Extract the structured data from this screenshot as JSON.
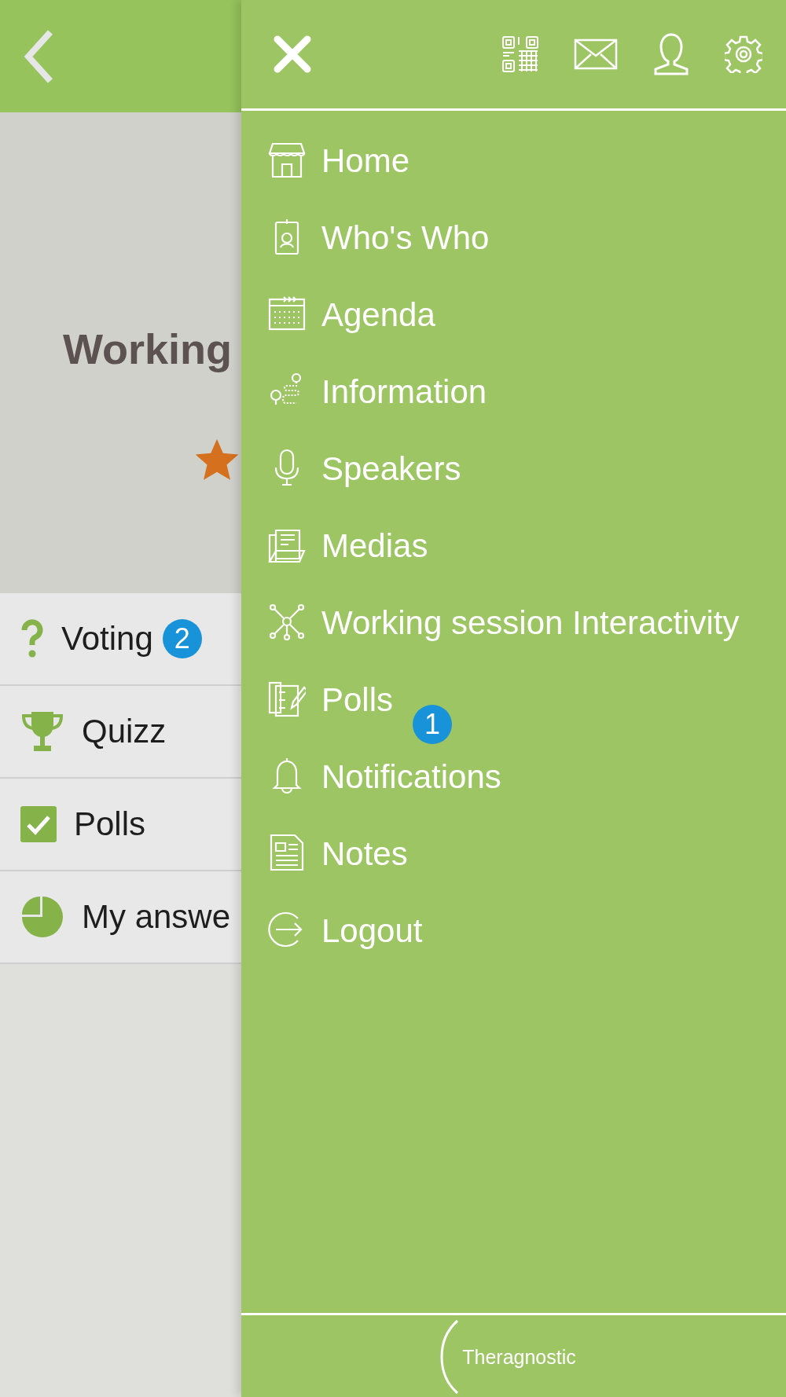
{
  "page": {
    "title": "Working",
    "list": [
      {
        "label": "Voting",
        "kind": "question",
        "badge": "2"
      },
      {
        "label": "Quizz",
        "kind": "trophy"
      },
      {
        "label": "Polls",
        "kind": "check"
      },
      {
        "label": "My answe",
        "kind": "pie"
      }
    ]
  },
  "menu": {
    "items": [
      {
        "label": "Home",
        "kind": "store"
      },
      {
        "label": "Who's Who",
        "kind": "badge"
      },
      {
        "label": "Agenda",
        "kind": "calendar"
      },
      {
        "label": "Information",
        "kind": "map"
      },
      {
        "label": "Speakers",
        "kind": "mic"
      },
      {
        "label": "Medias",
        "kind": "folder"
      },
      {
        "label": "Working session Interactivity",
        "kind": "network"
      },
      {
        "label": "Polls",
        "kind": "poll",
        "badge": "1"
      },
      {
        "label": "Notifications",
        "kind": "bell"
      },
      {
        "label": "Notes",
        "kind": "note"
      },
      {
        "label": "Logout",
        "kind": "logout"
      }
    ],
    "footer_logo": "Theragnostic"
  }
}
